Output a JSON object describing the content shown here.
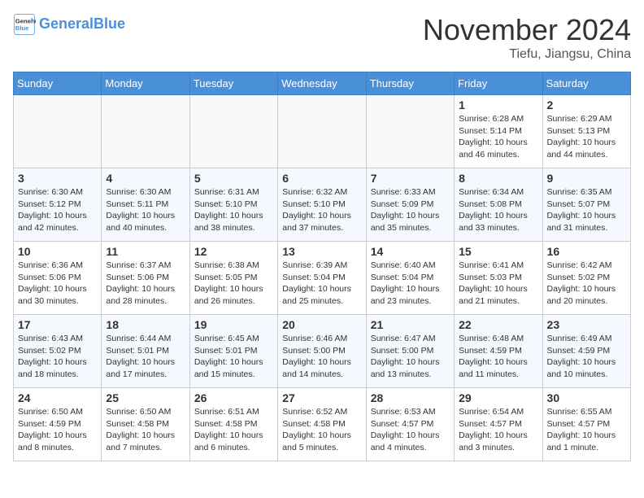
{
  "header": {
    "logo_line1": "General",
    "logo_line2": "Blue",
    "month_title": "November 2024",
    "location": "Tiefu, Jiangsu, China"
  },
  "weekdays": [
    "Sunday",
    "Monday",
    "Tuesday",
    "Wednesday",
    "Thursday",
    "Friday",
    "Saturday"
  ],
  "weeks": [
    [
      {
        "day": "",
        "info": ""
      },
      {
        "day": "",
        "info": ""
      },
      {
        "day": "",
        "info": ""
      },
      {
        "day": "",
        "info": ""
      },
      {
        "day": "",
        "info": ""
      },
      {
        "day": "1",
        "info": "Sunrise: 6:28 AM\nSunset: 5:14 PM\nDaylight: 10 hours and 46 minutes."
      },
      {
        "day": "2",
        "info": "Sunrise: 6:29 AM\nSunset: 5:13 PM\nDaylight: 10 hours and 44 minutes."
      }
    ],
    [
      {
        "day": "3",
        "info": "Sunrise: 6:30 AM\nSunset: 5:12 PM\nDaylight: 10 hours and 42 minutes."
      },
      {
        "day": "4",
        "info": "Sunrise: 6:30 AM\nSunset: 5:11 PM\nDaylight: 10 hours and 40 minutes."
      },
      {
        "day": "5",
        "info": "Sunrise: 6:31 AM\nSunset: 5:10 PM\nDaylight: 10 hours and 38 minutes."
      },
      {
        "day": "6",
        "info": "Sunrise: 6:32 AM\nSunset: 5:10 PM\nDaylight: 10 hours and 37 minutes."
      },
      {
        "day": "7",
        "info": "Sunrise: 6:33 AM\nSunset: 5:09 PM\nDaylight: 10 hours and 35 minutes."
      },
      {
        "day": "8",
        "info": "Sunrise: 6:34 AM\nSunset: 5:08 PM\nDaylight: 10 hours and 33 minutes."
      },
      {
        "day": "9",
        "info": "Sunrise: 6:35 AM\nSunset: 5:07 PM\nDaylight: 10 hours and 31 minutes."
      }
    ],
    [
      {
        "day": "10",
        "info": "Sunrise: 6:36 AM\nSunset: 5:06 PM\nDaylight: 10 hours and 30 minutes."
      },
      {
        "day": "11",
        "info": "Sunrise: 6:37 AM\nSunset: 5:06 PM\nDaylight: 10 hours and 28 minutes."
      },
      {
        "day": "12",
        "info": "Sunrise: 6:38 AM\nSunset: 5:05 PM\nDaylight: 10 hours and 26 minutes."
      },
      {
        "day": "13",
        "info": "Sunrise: 6:39 AM\nSunset: 5:04 PM\nDaylight: 10 hours and 25 minutes."
      },
      {
        "day": "14",
        "info": "Sunrise: 6:40 AM\nSunset: 5:04 PM\nDaylight: 10 hours and 23 minutes."
      },
      {
        "day": "15",
        "info": "Sunrise: 6:41 AM\nSunset: 5:03 PM\nDaylight: 10 hours and 21 minutes."
      },
      {
        "day": "16",
        "info": "Sunrise: 6:42 AM\nSunset: 5:02 PM\nDaylight: 10 hours and 20 minutes."
      }
    ],
    [
      {
        "day": "17",
        "info": "Sunrise: 6:43 AM\nSunset: 5:02 PM\nDaylight: 10 hours and 18 minutes."
      },
      {
        "day": "18",
        "info": "Sunrise: 6:44 AM\nSunset: 5:01 PM\nDaylight: 10 hours and 17 minutes."
      },
      {
        "day": "19",
        "info": "Sunrise: 6:45 AM\nSunset: 5:01 PM\nDaylight: 10 hours and 15 minutes."
      },
      {
        "day": "20",
        "info": "Sunrise: 6:46 AM\nSunset: 5:00 PM\nDaylight: 10 hours and 14 minutes."
      },
      {
        "day": "21",
        "info": "Sunrise: 6:47 AM\nSunset: 5:00 PM\nDaylight: 10 hours and 13 minutes."
      },
      {
        "day": "22",
        "info": "Sunrise: 6:48 AM\nSunset: 4:59 PM\nDaylight: 10 hours and 11 minutes."
      },
      {
        "day": "23",
        "info": "Sunrise: 6:49 AM\nSunset: 4:59 PM\nDaylight: 10 hours and 10 minutes."
      }
    ],
    [
      {
        "day": "24",
        "info": "Sunrise: 6:50 AM\nSunset: 4:59 PM\nDaylight: 10 hours and 8 minutes."
      },
      {
        "day": "25",
        "info": "Sunrise: 6:50 AM\nSunset: 4:58 PM\nDaylight: 10 hours and 7 minutes."
      },
      {
        "day": "26",
        "info": "Sunrise: 6:51 AM\nSunset: 4:58 PM\nDaylight: 10 hours and 6 minutes."
      },
      {
        "day": "27",
        "info": "Sunrise: 6:52 AM\nSunset: 4:58 PM\nDaylight: 10 hours and 5 minutes."
      },
      {
        "day": "28",
        "info": "Sunrise: 6:53 AM\nSunset: 4:57 PM\nDaylight: 10 hours and 4 minutes."
      },
      {
        "day": "29",
        "info": "Sunrise: 6:54 AM\nSunset: 4:57 PM\nDaylight: 10 hours and 3 minutes."
      },
      {
        "day": "30",
        "info": "Sunrise: 6:55 AM\nSunset: 4:57 PM\nDaylight: 10 hours and 1 minute."
      }
    ]
  ]
}
